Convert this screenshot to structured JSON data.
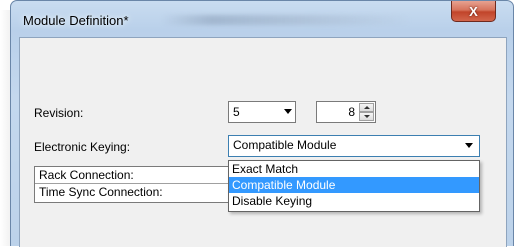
{
  "window": {
    "title": "Module Definition*",
    "close_glyph": "X"
  },
  "revision": {
    "label": "Revision:",
    "major": "5",
    "minor": "8"
  },
  "electronic_keying": {
    "label": "Electronic Keying:",
    "selected": "Compatible Module",
    "options": [
      "Exact Match",
      "Compatible Module",
      "Disable Keying"
    ],
    "selected_index": 1
  },
  "connections": {
    "rack_label": "Rack Connection:",
    "time_sync_label": "Time Sync Connection:"
  },
  "colors": {
    "selection": "#3399ff",
    "close_button": "#c1442a",
    "focus_border": "#3c7fb1"
  }
}
